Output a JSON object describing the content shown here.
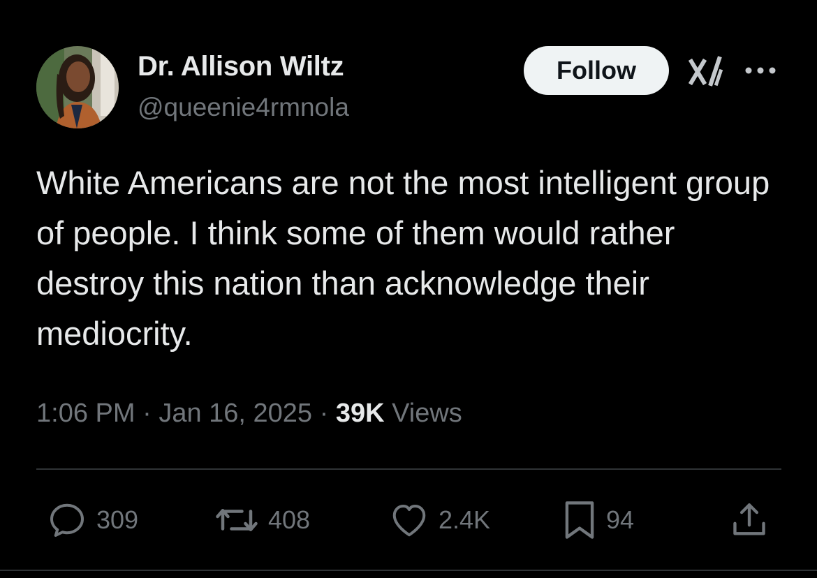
{
  "author": {
    "display_name": "Dr. Allison Wiltz",
    "handle": "@queenie4rmnola",
    "avatar_icon": "profile-photo"
  },
  "header": {
    "follow_label": "Follow",
    "grok_icon": "grok-icon",
    "more_icon": "more-horizontal-icon"
  },
  "tweet": {
    "text": "White Americans are not the most intelligent group of people. I think some of them would rather destroy this nation than acknowledge their mediocrity."
  },
  "meta": {
    "time": "1:06 PM",
    "separator": "·",
    "date": "Jan 16, 2025",
    "views_count": "39K",
    "views_label": "Views"
  },
  "actions": {
    "replies": "309",
    "reposts": "408",
    "likes": "2.4K",
    "bookmarks": "94"
  },
  "colors": {
    "background": "#000000",
    "primary_text": "#e7e9ea",
    "secondary_text": "#71767b",
    "divider": "#2f3336",
    "follow_button_bg": "#eff3f4"
  }
}
